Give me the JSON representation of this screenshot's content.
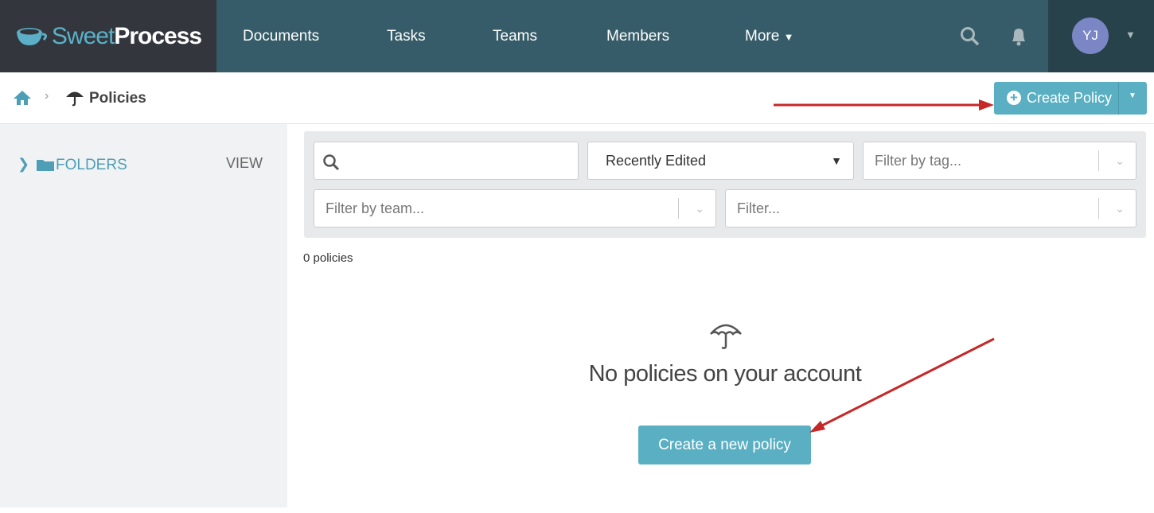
{
  "logo": {
    "part1": "Sweet",
    "part2": "Process"
  },
  "nav": {
    "items": [
      "Documents",
      "Tasks",
      "Teams",
      "Members"
    ],
    "more": "More"
  },
  "user": {
    "initials": "YJ"
  },
  "breadcrumb": {
    "current": "Policies"
  },
  "create_button": {
    "label": "Create Policy"
  },
  "sidebar": {
    "folders": "FOLDERS",
    "view": "VIEW"
  },
  "filters": {
    "search_placeholder": "",
    "sort": "Recently Edited",
    "tag_placeholder": "Filter by tag...",
    "team_placeholder": "Filter by team...",
    "filter_placeholder": "Filter..."
  },
  "count": "0 policies",
  "empty": {
    "title": "No policies on your account",
    "button": "Create a new policy"
  },
  "colors": {
    "accent": "#5aafc2",
    "nav": "#355c68",
    "annotation": "#c62828"
  }
}
